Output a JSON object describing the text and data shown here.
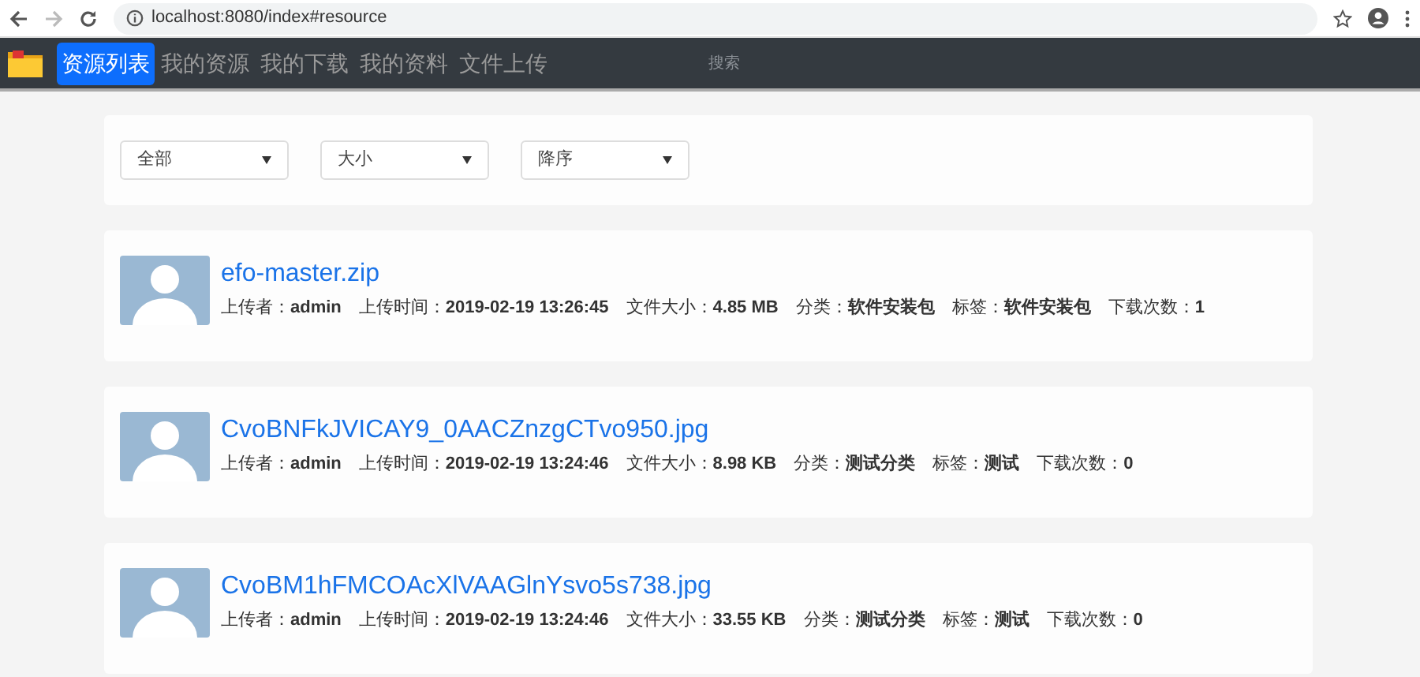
{
  "browser": {
    "url": "localhost:8080/index#resource"
  },
  "navbar": {
    "items": [
      {
        "label": "资源列表",
        "selected": true
      },
      {
        "label": "我的资源",
        "selected": false
      },
      {
        "label": "我的下载",
        "selected": false
      },
      {
        "label": "我的资料",
        "selected": false
      },
      {
        "label": "文件上传",
        "selected": false
      }
    ],
    "search": {
      "placeholder": "搜索"
    }
  },
  "filters": [
    {
      "value": "全部"
    },
    {
      "value": "大小"
    },
    {
      "value": "降序"
    }
  ],
  "resources": [
    {
      "name": "efo-master.zip",
      "meta": [
        "上传者：**admin**",
        "上传时间：**2019-02-19 13:26:45**",
        "文件大小：**4.85 MB**",
        "分类：**软件安装包**",
        "标签：**软件安装包**",
        "下载次数：**1**"
      ]
    },
    {
      "name": "CvoBNFkJVICAY9_0AACZnzgCTvo950.jpg",
      "meta": [
        "上传者：**admin**",
        "上传时间：**2019-02-19 13:24:46**",
        "文件大小：**8.98 KB**",
        "分类：**测试分类**",
        "标签：**测试**",
        "下载次数：**0**"
      ]
    },
    {
      "name": "CvoBM1hFMCOAcXlVAAGlnYsvo5s738.jpg",
      "meta": [
        "上传者：**admin**",
        "上传时间：**2019-02-19 13:24:46**",
        "文件大小：**33.55 KB**",
        "分类：**测试分类**",
        "标签：**测试**",
        "下载次数：**0**"
      ]
    }
  ]
}
